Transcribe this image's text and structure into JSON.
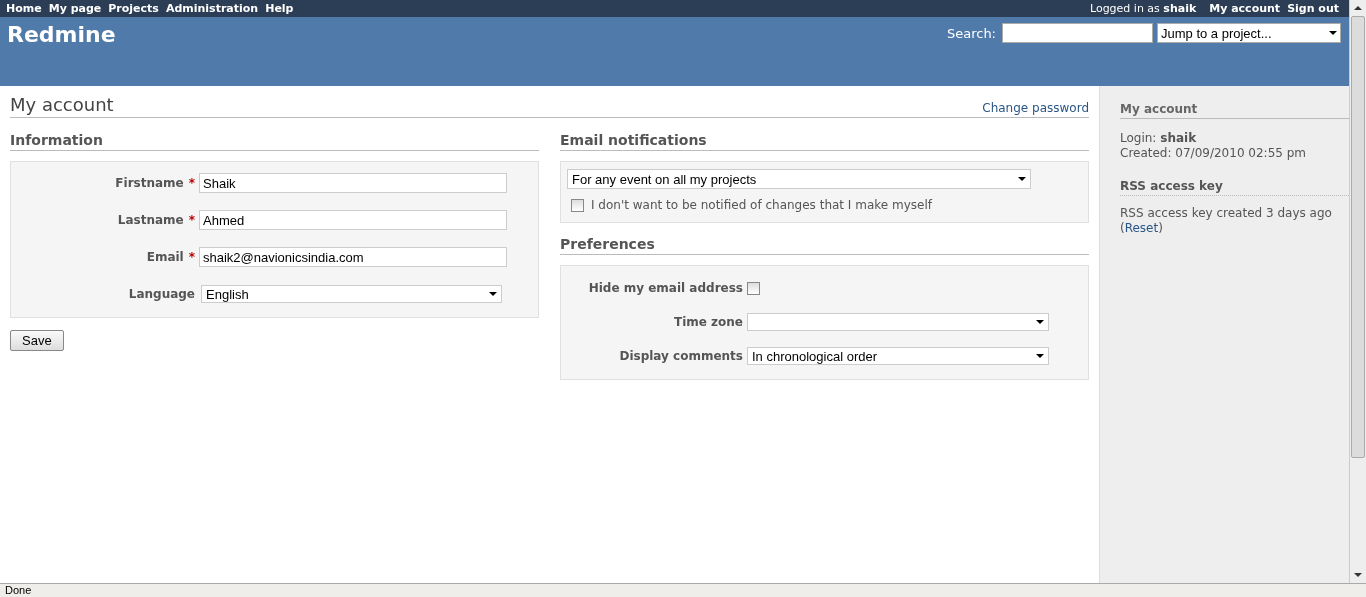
{
  "top_menu": {
    "items": [
      {
        "label": "Home"
      },
      {
        "label": "My page"
      },
      {
        "label": "Projects"
      },
      {
        "label": "Administration"
      },
      {
        "label": "Help"
      }
    ],
    "logged_in": "Logged in as **shaik**",
    "account_items": [
      {
        "label": "My account"
      },
      {
        "label": "Sign out"
      }
    ]
  },
  "header": {
    "title": "Redmine",
    "search_label": "Search:",
    "jump": {
      "value": "Jump to a project..."
    }
  },
  "page": {
    "title": "My account",
    "change_password": "Change password"
  },
  "information": {
    "heading": "Information",
    "fields": [
      {
        "label": "Firstname",
        "required_mark": "*",
        "kind": "text",
        "value": "Shaik"
      },
      {
        "label": "Lastname",
        "required_mark": "*",
        "kind": "text",
        "value": "Ahmed"
      },
      {
        "label": "Email",
        "required_mark": "*",
        "kind": "text",
        "value": "shaik2@navionicsindia.com"
      },
      {
        "label": "Language",
        "kind": "select",
        "value": "English"
      }
    ],
    "save": "Save"
  },
  "notifications": {
    "heading": "Email notifications",
    "select": {
      "value": "For any event on all my projects"
    },
    "no_self": {
      "label": "I don't want to be notified of changes that I make myself",
      "checked": false
    }
  },
  "preferences": {
    "heading": "Preferences",
    "fields": [
      {
        "label": "Hide my email address",
        "kind": "checkbox",
        "checked": false
      },
      {
        "label": "Time zone",
        "kind": "select"
      },
      {
        "label": "Display comments",
        "kind": "select",
        "value": "In chronological order"
      }
    ]
  },
  "sidebar": {
    "heading": "My account",
    "login": "Login: **shaik**",
    "created": "Created: 07/09/2010 02:55 pm",
    "rss_heading": "RSS access key",
    "rss_text": "RSS access key created 3 days ago",
    "paren_open": "(",
    "reset": "Reset",
    "paren_close": ")"
  },
  "status_bar": {
    "text": "Done"
  }
}
